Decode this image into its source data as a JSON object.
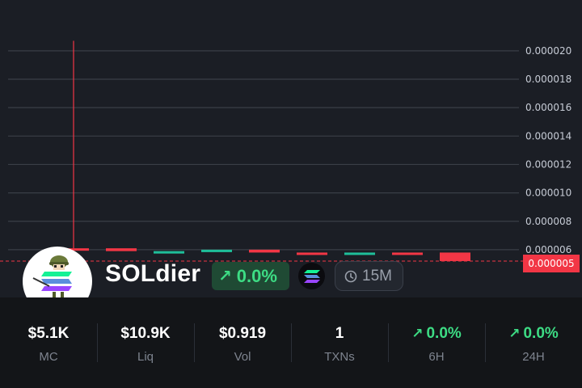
{
  "chart_data": {
    "type": "candlestick",
    "y_ticks": [
      "0.000020",
      "0.000018",
      "0.000016",
      "0.000014",
      "0.000012",
      "0.000010",
      "0.000008",
      "0.000006"
    ],
    "ylim": [
      4.8e-06,
      2.13e-05
    ],
    "candles": [
      {
        "open": 6.1e-06,
        "close": 6e-06,
        "high": 2.07e-05,
        "low": 6e-06,
        "color": "#f23645"
      },
      {
        "open": 6.1e-06,
        "close": 5.9e-06,
        "high": 6.1e-06,
        "low": 5.9e-06,
        "color": "#f23645"
      },
      {
        "open": 5.8e-06,
        "close": 5.9e-06,
        "high": 5.9e-06,
        "low": 5.8e-06,
        "color": "#1fbf9a"
      },
      {
        "open": 5.9e-06,
        "close": 6e-06,
        "high": 6e-06,
        "low": 5.9e-06,
        "color": "#1fbf9a"
      },
      {
        "open": 6e-06,
        "close": 5.8e-06,
        "high": 6e-06,
        "low": 5.8e-06,
        "color": "#f23645"
      },
      {
        "open": 5.8e-06,
        "close": 5.7e-06,
        "high": 5.8e-06,
        "low": 5.7e-06,
        "color": "#f23645"
      },
      {
        "open": 5.7e-06,
        "close": 5.8e-06,
        "high": 5.8e-06,
        "low": 5.7e-06,
        "color": "#1fbf9a"
      },
      {
        "open": 5.8e-06,
        "close": 5.7e-06,
        "high": 5.8e-06,
        "low": 5.7e-06,
        "color": "#f23645"
      },
      {
        "open": 5.8e-06,
        "close": 5.2e-06,
        "high": 5.8e-06,
        "low": 5.2e-06,
        "color": "#f23645"
      }
    ],
    "last_price": "0.000005",
    "last_price_value": 5.2e-06,
    "colors": {
      "up": "#1fbf9a",
      "down": "#f23645",
      "grid": "#3a3e47"
    }
  },
  "token": {
    "name": "SOLdier",
    "change": "0.0%",
    "chain_icon": "solana-icon",
    "interval": "15M",
    "interval_icon": "clock-icon",
    "avatar_icon": "soldier-avatar-icon"
  },
  "stats": [
    {
      "value": "$5.1K",
      "label": "MC"
    },
    {
      "value": "$10.9K",
      "label": "Liq"
    },
    {
      "value": "$0.919",
      "label": "Vol"
    },
    {
      "value": "1",
      "label": "TXNs"
    },
    {
      "value": "0.0%",
      "label": "6H",
      "trend": "up"
    },
    {
      "value": "0.0%",
      "label": "24H",
      "trend": "up"
    }
  ],
  "colors": {
    "accent_green": "#3ddc84",
    "accent_red": "#f23645",
    "background": "#1b1e25"
  }
}
